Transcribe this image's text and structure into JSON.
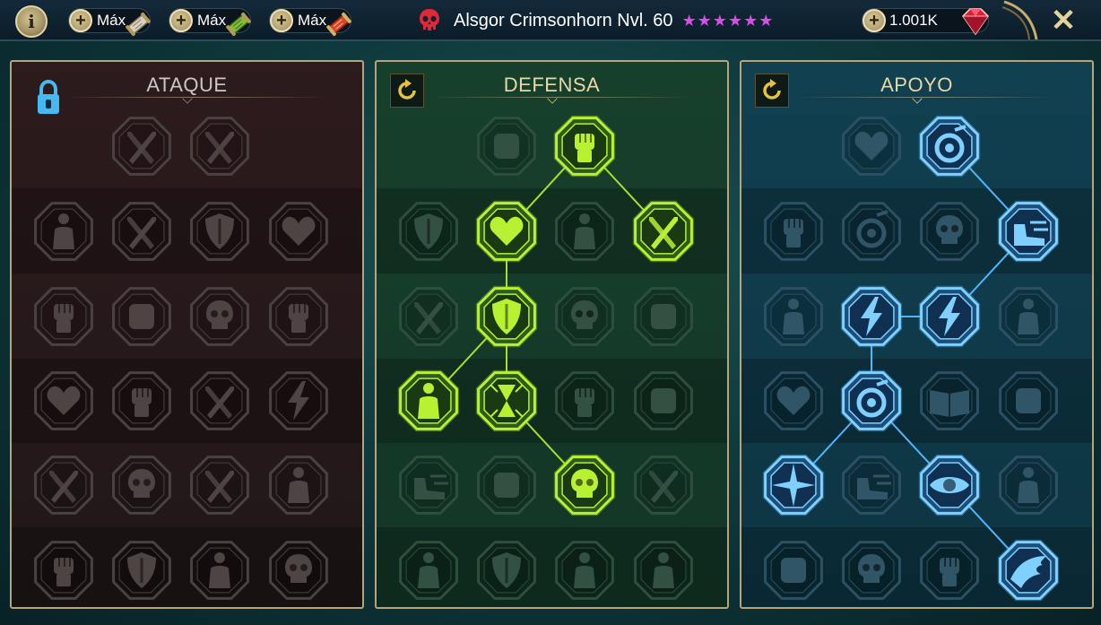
{
  "topbar": {
    "info_label": "i",
    "boosts": [
      {
        "label": "Máx",
        "icon": "scroll-white-icon",
        "color": "#d9d1c3"
      },
      {
        "label": "Máx",
        "icon": "scroll-green-icon",
        "color": "#7fbe3a"
      },
      {
        "label": "Máx",
        "icon": "scroll-red-icon",
        "color": "#d8452e"
      }
    ],
    "hero_name": "Alsgor Crimsonhorn Nvl. 60",
    "stars": "★★★★★★",
    "gems": "1.001K",
    "close_label": "✕"
  },
  "panels": [
    {
      "key": "attack",
      "title": "ATAQUE",
      "state": "locked",
      "accent": "#8e8a88"
    },
    {
      "key": "defense",
      "title": "DEFENSA",
      "state": "active",
      "accent": "#a9e02c"
    },
    {
      "key": "support",
      "title": "APOYO",
      "state": "active",
      "accent": "#4fb6ff"
    }
  ],
  "colors": {
    "attack_bg": "#2d1b1d",
    "defense_bg": "#17402c",
    "support_bg": "#114050",
    "frame_gold": "#b6a57a",
    "defense_glow": "#a9e02c",
    "support_glow": "#4fb6ff"
  },
  "trees": {
    "attack": {
      "nodes": [
        {
          "row": 0,
          "col": 1,
          "active": false,
          "icon": "crossed-swords-icon"
        },
        {
          "row": 0,
          "col": 2,
          "active": false,
          "icon": "claw-slash-icon"
        },
        {
          "row": 1,
          "col": 0,
          "active": false,
          "icon": "horned-figure-icon"
        },
        {
          "row": 1,
          "col": 1,
          "active": false,
          "icon": "spear-cloak-icon"
        },
        {
          "row": 1,
          "col": 2,
          "active": false,
          "icon": "shield-strike-icon"
        },
        {
          "row": 1,
          "col": 3,
          "active": false,
          "icon": "bleeding-heart-icon"
        },
        {
          "row": 2,
          "col": 0,
          "active": false,
          "icon": "punch-icon"
        },
        {
          "row": 2,
          "col": 1,
          "active": false,
          "icon": "fangs-icon"
        },
        {
          "row": 2,
          "col": 2,
          "active": false,
          "icon": "skull-cloak-icon"
        },
        {
          "row": 2,
          "col": 3,
          "active": false,
          "icon": "fist-slash-icon"
        },
        {
          "row": 3,
          "col": 0,
          "active": false,
          "icon": "heart-sword-icon"
        },
        {
          "row": 3,
          "col": 1,
          "active": false,
          "icon": "gauntlet-icon"
        },
        {
          "row": 3,
          "col": 2,
          "active": false,
          "icon": "axe-icon"
        },
        {
          "row": 3,
          "col": 3,
          "active": false,
          "icon": "chain-lightning-icon"
        },
        {
          "row": 4,
          "col": 0,
          "active": false,
          "icon": "helmet-blades-icon"
        },
        {
          "row": 4,
          "col": 1,
          "active": false,
          "icon": "skull-icon"
        },
        {
          "row": 4,
          "col": 2,
          "active": false,
          "icon": "dagger-circle-icon"
        },
        {
          "row": 4,
          "col": 3,
          "active": false,
          "icon": "warrior-icon"
        },
        {
          "row": 5,
          "col": 0,
          "active": false,
          "icon": "sword-hand-icon"
        },
        {
          "row": 5,
          "col": 1,
          "active": false,
          "icon": "knight-helm-icon"
        },
        {
          "row": 5,
          "col": 2,
          "active": false,
          "icon": "demon-icon"
        },
        {
          "row": 5,
          "col": 3,
          "active": false,
          "icon": "skull-mace-icon"
        }
      ],
      "links": []
    },
    "defense": {
      "nodes": [
        {
          "row": 0,
          "col": 1,
          "active": false,
          "icon": "wall-icon"
        },
        {
          "row": 0,
          "col": 2,
          "active": true,
          "icon": "fist-icon"
        },
        {
          "row": 1,
          "col": 0,
          "active": false,
          "icon": "chevron-shield-icon"
        },
        {
          "row": 1,
          "col": 1,
          "active": true,
          "icon": "heart-icon"
        },
        {
          "row": 1,
          "col": 2,
          "active": false,
          "icon": "brute-icon"
        },
        {
          "row": 1,
          "col": 3,
          "active": true,
          "icon": "broken-blade-icon"
        },
        {
          "row": 2,
          "col": 0,
          "active": false,
          "icon": "sword-cloak-icon"
        },
        {
          "row": 2,
          "col": 1,
          "active": true,
          "icon": "knight-shield-icon"
        },
        {
          "row": 2,
          "col": 2,
          "active": false,
          "icon": "skull-shadow-icon"
        },
        {
          "row": 2,
          "col": 3,
          "active": false,
          "icon": "face-hood-icon"
        },
        {
          "row": 3,
          "col": 0,
          "active": true,
          "icon": "crowd-icon"
        },
        {
          "row": 3,
          "col": 1,
          "active": true,
          "icon": "hourglass-icon"
        },
        {
          "row": 3,
          "col": 2,
          "active": false,
          "icon": "open-hand-icon"
        },
        {
          "row": 3,
          "col": 3,
          "active": false,
          "icon": "bull-icon"
        },
        {
          "row": 4,
          "col": 0,
          "active": false,
          "icon": "sprint-icon"
        },
        {
          "row": 4,
          "col": 1,
          "active": false,
          "icon": "spikes-icon"
        },
        {
          "row": 4,
          "col": 2,
          "active": true,
          "icon": "skull-burst-icon"
        },
        {
          "row": 4,
          "col": 3,
          "active": false,
          "icon": "slash-arrow-icon"
        },
        {
          "row": 5,
          "col": 0,
          "active": false,
          "icon": "golem-icon"
        },
        {
          "row": 5,
          "col": 1,
          "active": false,
          "icon": "winged-shield-icon"
        },
        {
          "row": 5,
          "col": 2,
          "active": false,
          "icon": "executioner-icon"
        },
        {
          "row": 5,
          "col": 3,
          "active": false,
          "icon": "strongman-icon"
        }
      ],
      "links": [
        [
          0,
          2,
          1,
          1
        ],
        [
          0,
          2,
          1,
          3
        ],
        [
          1,
          1,
          2,
          1
        ],
        [
          2,
          1,
          3,
          0
        ],
        [
          2,
          1,
          3,
          1
        ],
        [
          3,
          1,
          4,
          2
        ]
      ]
    },
    "support": {
      "nodes": [
        {
          "row": 0,
          "col": 1,
          "active": false,
          "icon": "heart-plus-icon"
        },
        {
          "row": 0,
          "col": 2,
          "active": true,
          "icon": "vortex-icon"
        },
        {
          "row": 1,
          "col": 0,
          "active": false,
          "icon": "praying-hands-icon"
        },
        {
          "row": 1,
          "col": 1,
          "active": false,
          "icon": "aura-icon"
        },
        {
          "row": 1,
          "col": 2,
          "active": false,
          "icon": "flame-skull-icon"
        },
        {
          "row": 1,
          "col": 3,
          "active": true,
          "icon": "dash-foot-icon"
        },
        {
          "row": 2,
          "col": 0,
          "active": false,
          "icon": "sparkle-figure-icon"
        },
        {
          "row": 2,
          "col": 1,
          "active": true,
          "icon": "lightning-icon"
        },
        {
          "row": 2,
          "col": 2,
          "active": true,
          "icon": "shatter-icon"
        },
        {
          "row": 2,
          "col": 3,
          "active": false,
          "icon": "silhouette-icon"
        },
        {
          "row": 3,
          "col": 0,
          "active": false,
          "icon": "chained-heart-icon"
        },
        {
          "row": 3,
          "col": 1,
          "active": true,
          "icon": "comet-icon"
        },
        {
          "row": 3,
          "col": 2,
          "active": false,
          "icon": "book-icon"
        },
        {
          "row": 3,
          "col": 3,
          "active": false,
          "icon": "angry-face-icon"
        },
        {
          "row": 4,
          "col": 0,
          "active": true,
          "icon": "compass-star-icon"
        },
        {
          "row": 4,
          "col": 1,
          "active": false,
          "icon": "boots-icon"
        },
        {
          "row": 4,
          "col": 2,
          "active": true,
          "icon": "eye-icon"
        },
        {
          "row": 4,
          "col": 3,
          "active": false,
          "icon": "scarecrow-icon"
        },
        {
          "row": 5,
          "col": 0,
          "active": false,
          "icon": "potion-icon"
        },
        {
          "row": 5,
          "col": 1,
          "active": false,
          "icon": "skull-icon"
        },
        {
          "row": 5,
          "col": 2,
          "active": false,
          "icon": "grasp-icon"
        },
        {
          "row": 5,
          "col": 3,
          "active": true,
          "icon": "eagle-icon"
        }
      ],
      "links": [
        [
          0,
          2,
          1,
          3
        ],
        [
          1,
          3,
          2,
          2
        ],
        [
          2,
          1,
          2,
          2
        ],
        [
          2,
          1,
          3,
          1
        ],
        [
          3,
          1,
          4,
          0
        ],
        [
          3,
          1,
          4,
          2
        ],
        [
          4,
          2,
          5,
          3
        ]
      ]
    }
  }
}
